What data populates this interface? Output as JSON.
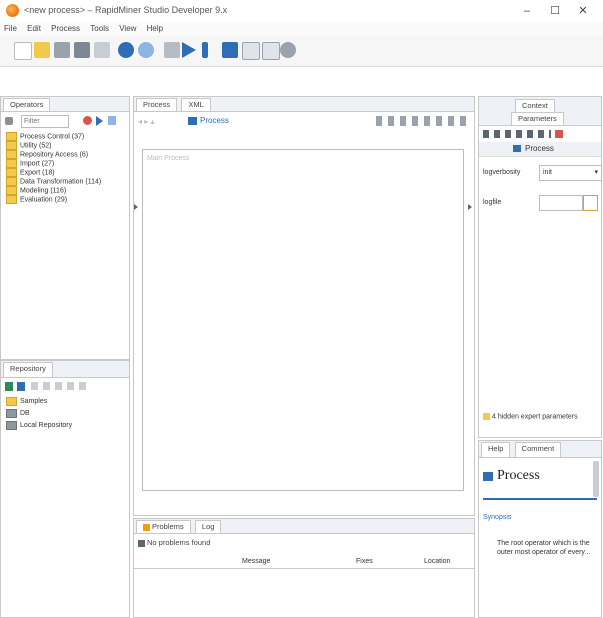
{
  "window": {
    "title": "<new process> – RapidMiner Studio Developer 9.x",
    "controls": [
      "–",
      "☐",
      "✕"
    ]
  },
  "menubar": [
    "File",
    "Edit",
    "Process",
    "Tools",
    "View",
    "Help"
  ],
  "operators_panel": {
    "tab": "Operators",
    "search_placeholder": "Filter",
    "items": [
      "Process Control (37)",
      "Utility (52)",
      "Repository Access (6)",
      "Import (27)",
      "Export (18)",
      "Data Transformation (114)",
      "Modeling (116)",
      "Evaluation (29)"
    ]
  },
  "repository_panel": {
    "tab": "Repository",
    "items": [
      "Samples",
      "DB",
      "Local Repository"
    ]
  },
  "process_panel": {
    "tabs": [
      "Process",
      "XML"
    ],
    "breadcrumb": "Process",
    "canvas_label": "Main Process"
  },
  "problems_panel": {
    "tabs": [
      "Problems",
      "Log"
    ],
    "status": "No problems found",
    "columns": [
      "Message",
      "Fixes",
      "Location"
    ]
  },
  "right_panel": {
    "tabs": [
      "Context",
      "Parameters"
    ],
    "header": "Process",
    "params": [
      {
        "label": "logverbosity",
        "value": "init"
      },
      {
        "label": "logfile",
        "value": ""
      }
    ],
    "hidden_params": "4 hidden expert parameters"
  },
  "help_panel": {
    "tabs": [
      "Help",
      "Comment"
    ],
    "title": "Process",
    "link": "Synopsis",
    "text": "The root operator which is the outer most operator of every..."
  },
  "colors": {
    "accent_blue": "#2f6db5",
    "orange": "#f39c12",
    "panel_border": "#c8c8c8"
  }
}
